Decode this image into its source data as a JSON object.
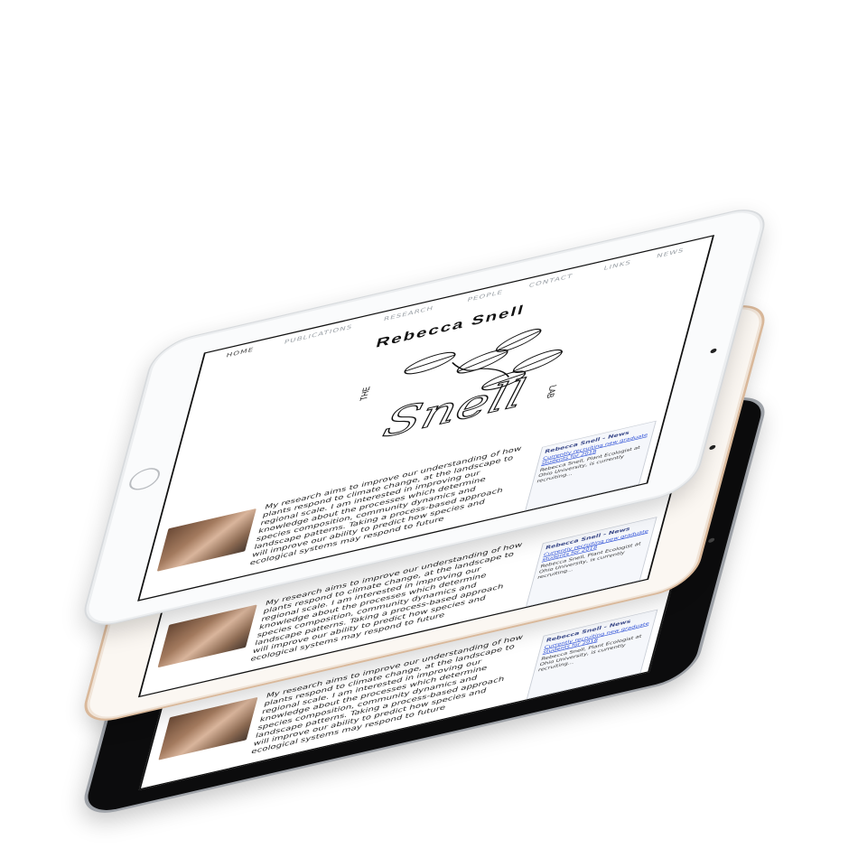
{
  "nav": {
    "items": [
      "HOME",
      "PUBLICATIONS",
      "RESEARCH",
      "PEOPLE",
      "CONTACT",
      "LINKS",
      "NEWS"
    ]
  },
  "site": {
    "title": "Rebecca Snell",
    "logo_text": "Snell",
    "logo_prefix": "THE",
    "logo_suffix": "LAB"
  },
  "bio": {
    "text": "My research aims to improve our understanding of how plants respond to climate change, at the landscape to regional scale. I am interested in improving our knowledge about the processes which determine species composition, community dynamics and landscape patterns. Taking a process-based approach will improve our ability to predict how species and ecological systems may respond to future"
  },
  "news": {
    "title": "Rebecca Snell - News",
    "link": "Currently recruiting new graduate students for 2018",
    "text": "Rebecca Snell, Plant Ecologist at Ohio University, is currently recruiting..."
  },
  "colors": {
    "white_frame": "#fafbfc",
    "gold_frame": "#d9b89a",
    "black_frame": "#0c0c0d",
    "link": "#2a4dd6"
  }
}
